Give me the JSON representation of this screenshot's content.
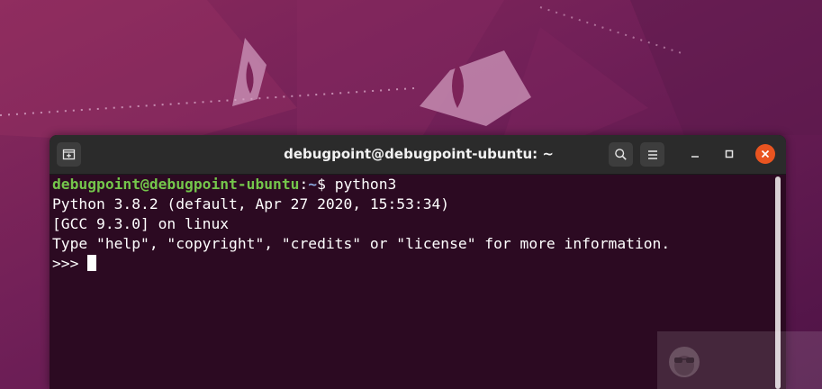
{
  "colors": {
    "accent": "#e95420",
    "prompt_user": "#74c64b",
    "prompt_path": "#8aa6dc",
    "terminal_bg": "#2c0a22",
    "titlebar_bg": "#2b2b2b"
  },
  "window": {
    "title": "debugpoint@debugpoint-ubuntu: ~",
    "buttons": {
      "new_tab_icon": "new-tab-icon",
      "search_icon": "search-icon",
      "menu_icon": "hamburger-menu-icon",
      "minimize_icon": "minimize-icon",
      "maximize_icon": "maximize-icon",
      "close_icon": "close-icon"
    }
  },
  "terminal": {
    "prompt": {
      "user_host": "debugpoint@debugpoint-ubuntu",
      "separator": ":",
      "path": "~",
      "symbol": "$ ",
      "command": "python3"
    },
    "output": [
      "Python 3.8.2 (default, Apr 27 2020, 15:53:34)",
      "[GCC 9.3.0] on linux",
      "Type \"help\", \"copyright\", \"credits\" or \"license\" for more information."
    ],
    "repl_prompt": ">>> "
  }
}
